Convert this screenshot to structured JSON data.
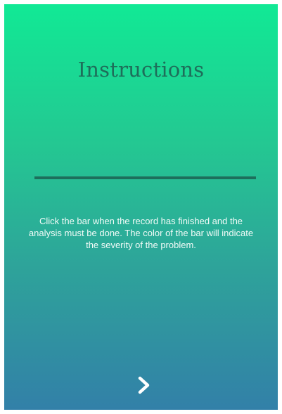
{
  "screen": {
    "title": "Instructions",
    "description": "Click the bar when the record has finished and the analysis must be done. The color of the bar will indicate the severity of the problem.",
    "bar_color": "#1d6f5c",
    "gradient_top": "#11e995",
    "gradient_bottom": "#3280a8",
    "next_icon": "chevron-right-icon"
  }
}
